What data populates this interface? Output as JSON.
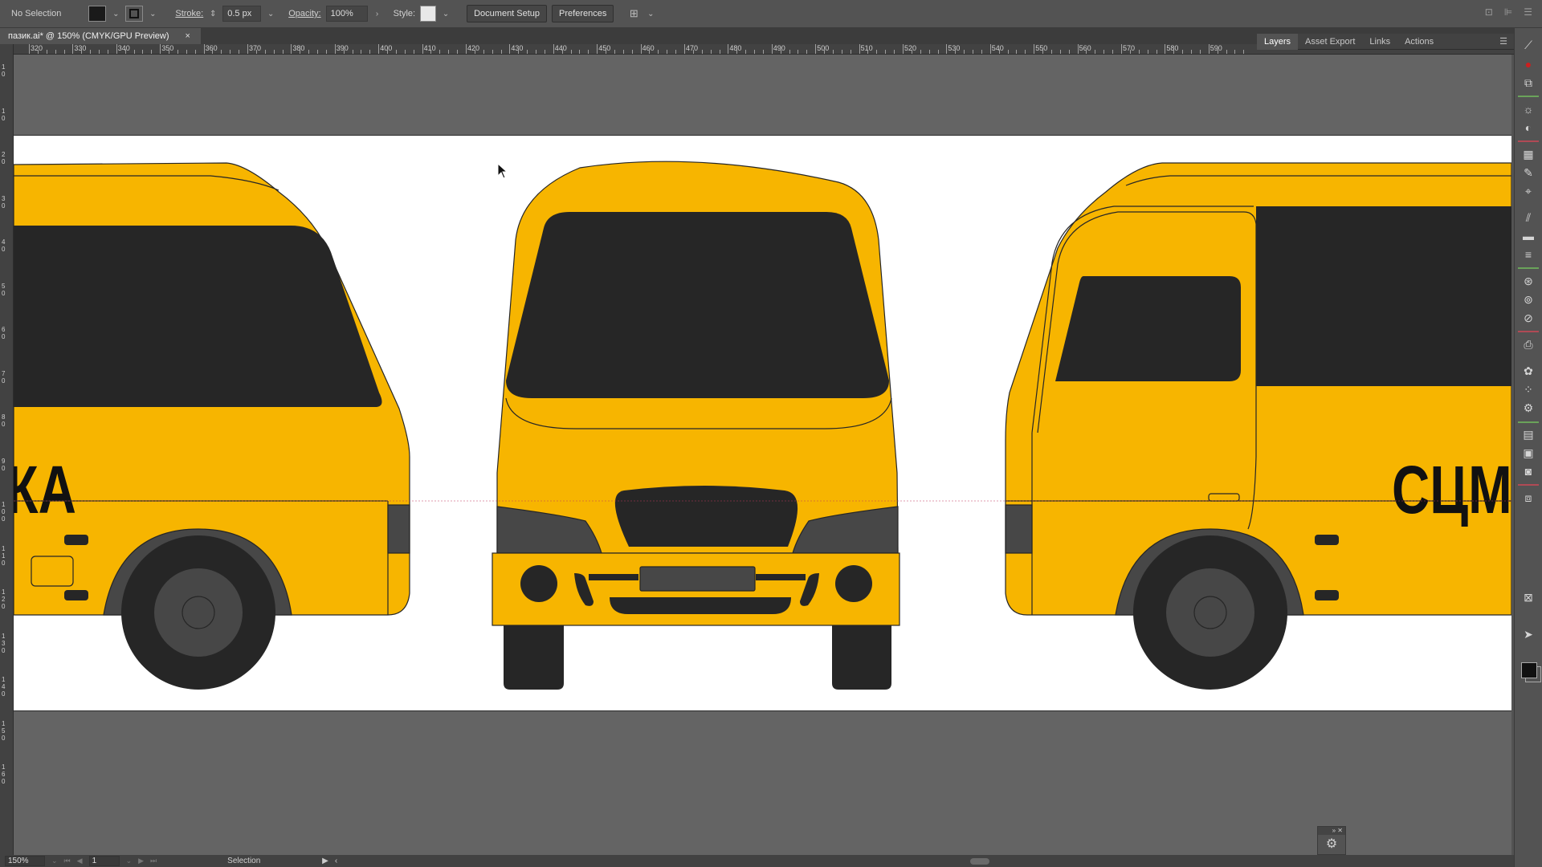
{
  "control_bar": {
    "selection_label": "No Selection",
    "stroke_label": "Stroke:",
    "stroke_value": "0.5 px",
    "opacity_label": "Opacity:",
    "opacity_value": "100%",
    "style_label": "Style:",
    "document_setup": "Document Setup",
    "preferences": "Preferences"
  },
  "document_tab": {
    "title": "пазик.ai* @ 150% (CMYK/GPU Preview)",
    "close": "×"
  },
  "ruler_top": {
    "labels": [
      "320",
      "330",
      "340",
      "350",
      "360",
      "370",
      "380",
      "390",
      "400",
      "410",
      "420",
      "430",
      "440",
      "450",
      "460",
      "470",
      "480",
      "490",
      "500",
      "510",
      "520",
      "530",
      "540",
      "550",
      "560",
      "570",
      "580",
      "590"
    ]
  },
  "ruler_left": {
    "labels": [
      "1 0",
      "1 0",
      "2 0",
      "3 0",
      "4 0",
      "5 0",
      "6 0",
      "7 0",
      "8 0",
      "9 0",
      "1 0 0",
      "1 1 0",
      "1 2 0",
      "1 3 0",
      "1 4 0",
      "1 5 0",
      "1 6 0"
    ]
  },
  "panel_tabs": [
    "Layers",
    "Asset Export",
    "Links",
    "Actions"
  ],
  "artwork": {
    "left_text": "КА",
    "right_text": "СЦМ I",
    "body_color": "#F7B500",
    "dark_color": "#262626",
    "grey_color": "#474747"
  },
  "status_bar": {
    "zoom": "150%",
    "artboard_number": "1",
    "tool": "Selection"
  },
  "dock": {
    "icons": [
      "magic-wand-icon",
      "color-icon",
      "color-guide-icon",
      "brightness-icon",
      "sphere-icon",
      "swatch-library-icon",
      "brush-icon",
      "transform-icon",
      "graphic-style-icon",
      "stroke-icon",
      "paragraph-icon",
      "pathfinder-icon",
      "appearance-icon",
      "align-icon",
      "print-icon",
      "symbol-icon",
      "scatter-icon",
      "settings-icon",
      "layers-icon",
      "image-icon",
      "logo-icon",
      "artboards-icon"
    ]
  }
}
